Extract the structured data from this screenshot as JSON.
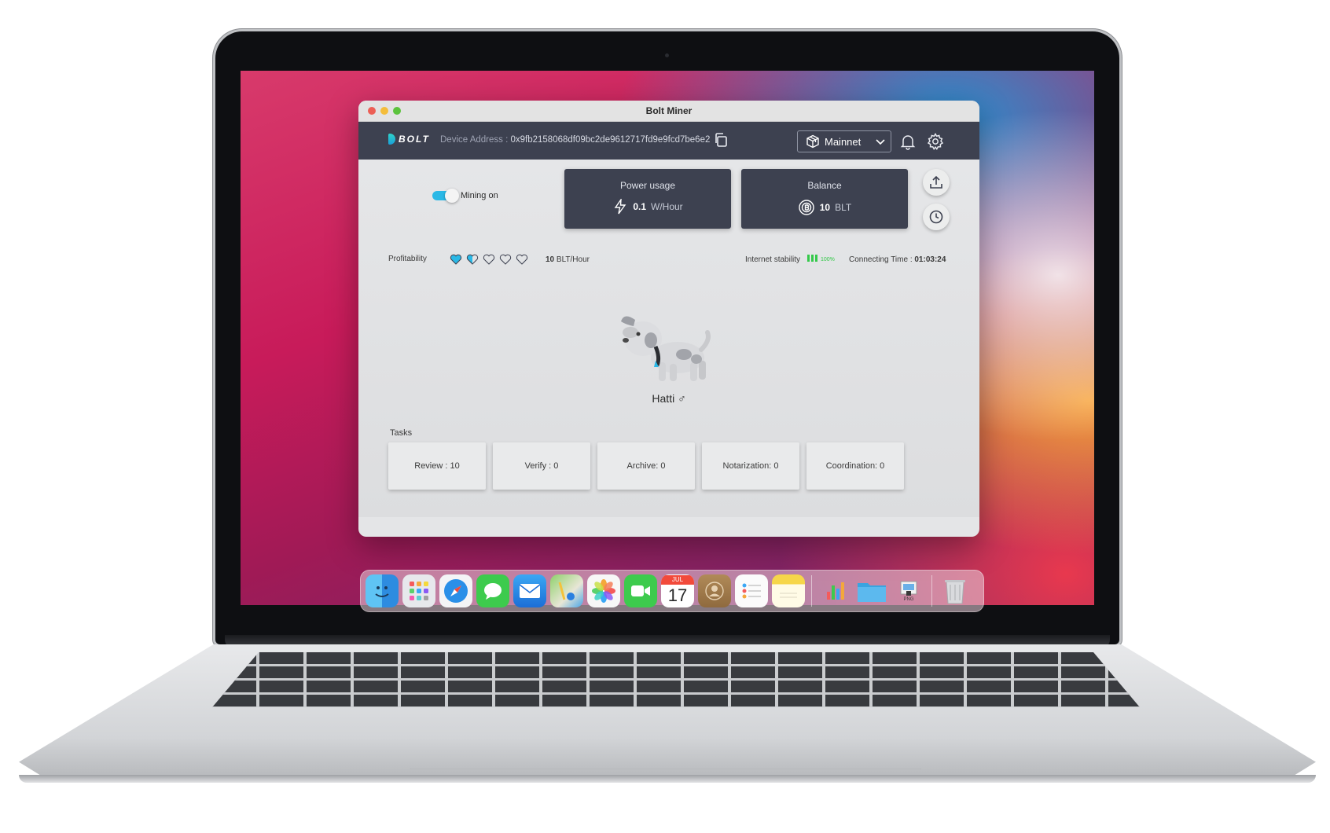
{
  "window": {
    "title": "Bolt Miner"
  },
  "header": {
    "logo_text": "BOLT",
    "device_address_label": "Device Address : ",
    "device_address": "0x9fb2158068df09bc2de9612717fd9e9fcd7be6e2",
    "network": "Mainnet"
  },
  "mining": {
    "toggle_label": "Mining on",
    "enabled": true
  },
  "power": {
    "title": "Power usage",
    "value": "0.1",
    "unit": "W/Hour"
  },
  "balance": {
    "title": "Balance",
    "value": "10",
    "unit": "BLT"
  },
  "profitability": {
    "label": "Profitability",
    "hearts_total": 5,
    "hearts_full": 1,
    "hearts_half": 1,
    "rate_value": "10",
    "rate_unit": "BLT/Hour"
  },
  "stability": {
    "label": "Internet stability",
    "percent": "100%"
  },
  "connection": {
    "label": "Connecting Time : ",
    "value": "01:03:24"
  },
  "pet": {
    "name": "Hatti ♂"
  },
  "tasks": {
    "label": "Tasks",
    "items": [
      "Review : 10",
      "Verify : 0",
      "Archive: 0",
      "Notarization: 0",
      "Coordination: 0"
    ]
  },
  "dock": {
    "calendar_month": "JUL",
    "calendar_day": "17",
    "preview_label": "PNG",
    "apps": [
      "finder-icon",
      "launchpad-icon",
      "safari-icon",
      "messages-icon",
      "mail-icon",
      "maps-icon",
      "photos-icon",
      "facetime-icon",
      "calendar-icon",
      "contacts-icon",
      "reminders-icon",
      "notes-icon",
      "numbers-icon",
      "folder-icon",
      "preview-icon",
      "trash-icon"
    ]
  },
  "colors": {
    "accent": "#2ab8e6",
    "appbar": "#3d4150",
    "stability": "#34c94a"
  }
}
